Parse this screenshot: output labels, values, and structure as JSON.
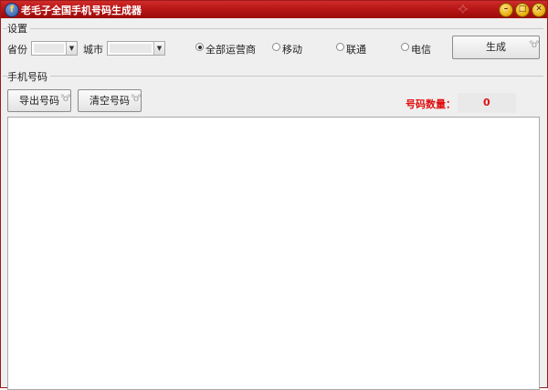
{
  "window": {
    "title": "老毛子全国手机号码生成器",
    "app_icon_glyph": "f",
    "minimize_glyph": "–",
    "maximize_glyph": "□",
    "close_glyph": "✕"
  },
  "settings": {
    "group_label": "设置",
    "province_label": "省份",
    "province_value": "",
    "city_label": "城市",
    "city_value": "",
    "carriers": [
      {
        "label": "全部运营商",
        "checked": true
      },
      {
        "label": "移动",
        "checked": false
      },
      {
        "label": "联通",
        "checked": false
      },
      {
        "label": "电信",
        "checked": false
      }
    ],
    "generate_label": "生成"
  },
  "numbers": {
    "group_label": "手机号码",
    "export_label": "导出号码",
    "clear_label": "清空号码",
    "count_label": "号码数量：",
    "count_value": "0",
    "output_text": ""
  },
  "colors": {
    "titlebar": "#b11212",
    "count_text": "#e01010"
  }
}
